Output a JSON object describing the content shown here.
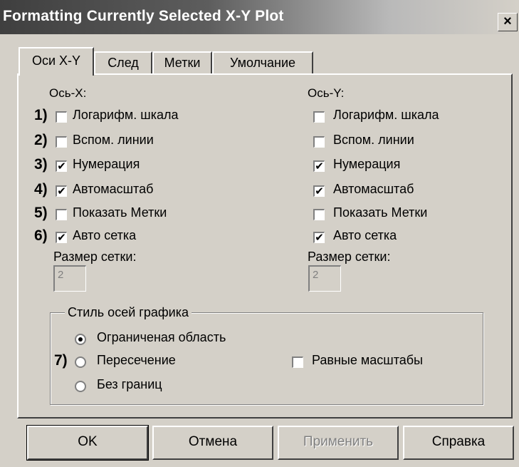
{
  "window": {
    "title": "Formatting Currently Selected X-Y Plot",
    "close_label": "×"
  },
  "tabs": [
    {
      "label": "Оси X-Y",
      "active": true
    },
    {
      "label": "След",
      "active": false
    },
    {
      "label": "Метки",
      "active": false
    },
    {
      "label": "Умолчание",
      "active": false
    }
  ],
  "axes": {
    "x": {
      "heading": "Ось-X:",
      "options": [
        {
          "num": "1)",
          "label": "Логарифм. шкала",
          "checked": false
        },
        {
          "num": "2)",
          "label": "Вспом. линии",
          "checked": false
        },
        {
          "num": "3)",
          "label": "Нумерация",
          "checked": true
        },
        {
          "num": "4)",
          "label": "Автомасштаб",
          "checked": true
        },
        {
          "num": "5)",
          "label": "Показать Метки",
          "checked": false
        },
        {
          "num": "6)",
          "label": "Авто сетка",
          "checked": true
        }
      ],
      "grid_size_label": "Размер сетки:",
      "grid_size_value": "2"
    },
    "y": {
      "heading": "Ось-Y:",
      "options": [
        {
          "label": "Логарифм. шкала",
          "checked": false
        },
        {
          "label": "Вспом. линии",
          "checked": false
        },
        {
          "label": "Нумерация",
          "checked": true
        },
        {
          "label": "Автомасштаб",
          "checked": true
        },
        {
          "label": "Показать Метки",
          "checked": false
        },
        {
          "label": "Авто сетка",
          "checked": true
        }
      ],
      "grid_size_label": "Размер сетки:",
      "grid_size_value": "2"
    }
  },
  "axis_style": {
    "title": "Стиль осей графика",
    "number_label": "7)",
    "options": [
      {
        "label": "Ограниченая область",
        "selected": true
      },
      {
        "label": "Пересечение",
        "selected": false
      },
      {
        "label": "Без границ",
        "selected": false
      }
    ],
    "equal_scales": {
      "label": "Равные масштабы",
      "checked": false
    }
  },
  "buttons": {
    "ok": "OK",
    "cancel": "Отмена",
    "apply": "Применить",
    "help": "Справка"
  },
  "check_mark": "✔"
}
